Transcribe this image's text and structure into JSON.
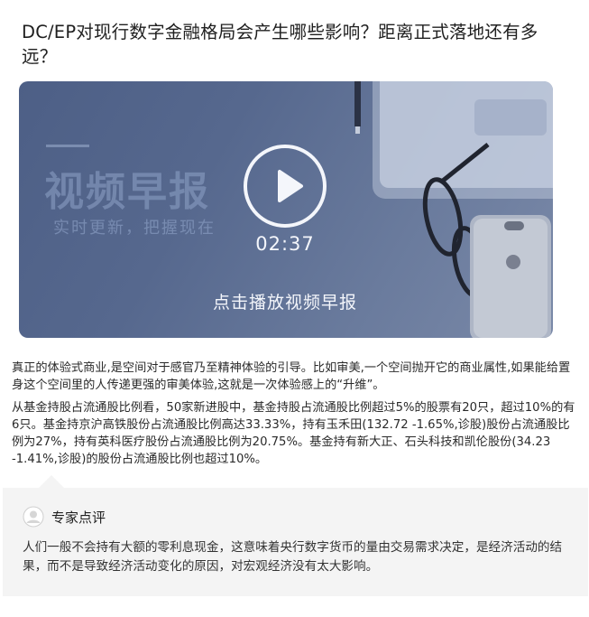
{
  "article": {
    "title": "DC/EP对现行数字金融格局会产生哪些影响？距离正式落地还有多远？"
  },
  "video": {
    "brand_title": "视频早报",
    "brand_subtitle": "实时更新，把握现在",
    "duration": "02:37",
    "cta": "点击播放视频早报"
  },
  "body": {
    "paragraph_1": "真正的体验式商业,是空间对于感官乃至精神体验的引导。比如审美,一个空间抛开它的商业属性,如果能给置身这个空间里的人传递更强的审美体验,这就是一次体验感上的“升维”。",
    "paragraph_2": "从基金持股占流通股比例看，50家新进股中，基金持股占流通股比例超过5%的股票有20只，超过10%的有6只。基金持京沪高铁股份占流通股比例高达33.33%，持有玉禾田(132.72 -1.65%,诊股)股份占流通股比例为27%，持有英科医疗股份占流通股比例为20.75%。基金持有新大正、石头科技和凯伦股份(34.23 -1.41%,诊股)的股份占流通股比例也超过10%。"
  },
  "expert": {
    "title": "专家点评",
    "comment": "人们一般不会持有大额的零利息现金，这意味着央行数字货币的量由交易需求决定，是经济活动的结果，而不是导致经济活动变化的原因，对宏观经济没有太大影响。"
  }
}
